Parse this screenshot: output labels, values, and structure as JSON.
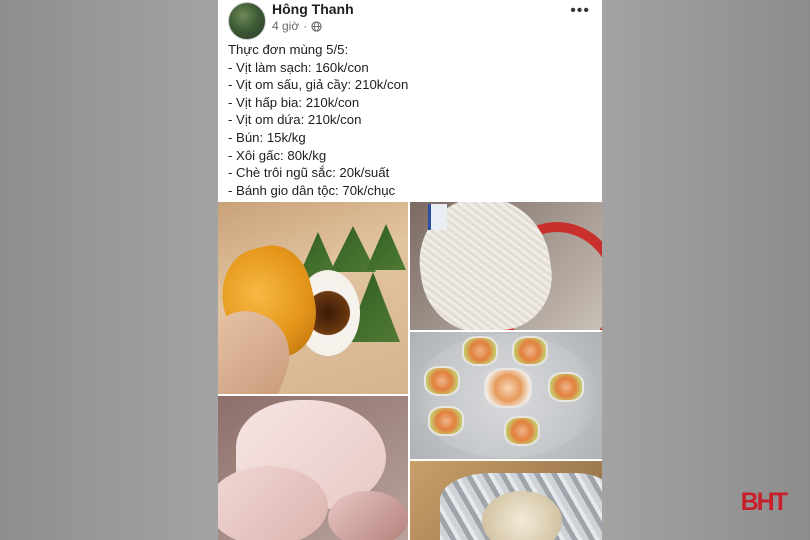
{
  "post": {
    "author": "Hông Thanh",
    "time": "4 giờ",
    "more_label": "•••",
    "lines": [
      "Thực đơn mùng 5/5:",
      "- Vịt làm sạch: 160k/con",
      "- Vịt om sấu, giả cầy: 210k/con",
      "- Vịt hấp bia: 210k/con",
      "- Vịt om dứa: 210k/con",
      "- Bún: 15k/kg",
      "- Xôi gấc: 80k/kg",
      "- Chè trôi ngũ sắc: 20k/suất",
      "- Bánh gio dân tộc: 70k/chục"
    ]
  },
  "watermark": "BHT",
  "colors": {
    "card_bg": "#ffffff",
    "background": "#9b9b9b",
    "watermark": "#c8202a",
    "text": "#1c1e21",
    "meta": "#65676b"
  },
  "icons": {
    "visibility": "globe-icon",
    "menu": "more-icon"
  }
}
